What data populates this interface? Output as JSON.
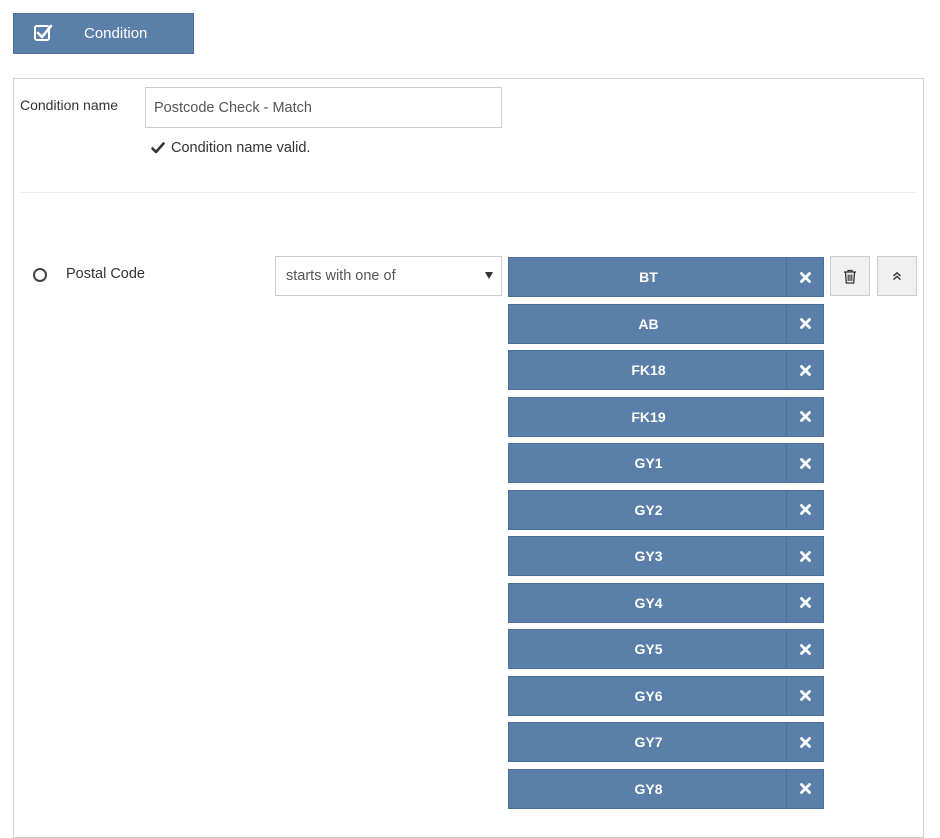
{
  "header": {
    "condition_button_label": "Condition",
    "condition_button_icon": "checkbox-check-icon"
  },
  "form": {
    "name_label": "Condition name",
    "name_value": "Postcode Check - Match",
    "validation_message": "Condition name valid.",
    "validation_icon": "checkmark-icon"
  },
  "rule": {
    "field_label": "Postal Code",
    "operator_value": "starts with one of",
    "values": [
      "BT",
      "AB",
      "FK18",
      "FK19",
      "GY1",
      "GY2",
      "GY3",
      "GY4",
      "GY5",
      "GY6",
      "GY7",
      "GY8"
    ],
    "remove_icon": "close-icon",
    "delete_icon": "trash-icon",
    "collapse_icon": "chevron-double-up-icon"
  },
  "colors": {
    "chip_bg": "#5a7fa8",
    "chip_border": "#4a6f98",
    "button_bg": "#f0f0f0"
  }
}
